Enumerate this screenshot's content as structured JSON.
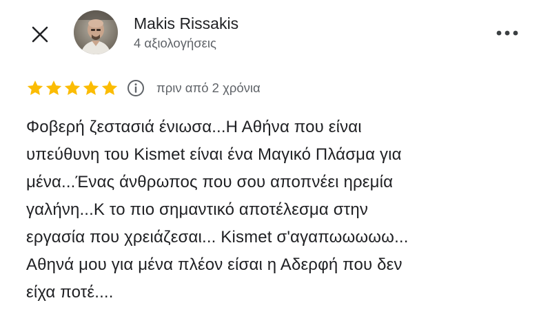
{
  "header": {
    "close_icon": "close-icon",
    "more_icon": "more-horizontal-icon"
  },
  "reviewer": {
    "name": "Makis Rissakis",
    "reviews_count": "4 αξιολογήσεις",
    "avatar_icon": "avatar-photo"
  },
  "review": {
    "rating": 5,
    "rating_max": 5,
    "star_color": "#fbbc04",
    "info_icon": "info-icon",
    "time_ago": "πριν από 2 χρόνια",
    "text": "Φοβερή ζεστασιά ένιωσα...Η Αθήνα που είναι\nυπεύθυνη του Kismet είναι ένα Μαγικό Πλάσμα για\nμένα...Ένας άνθρωπος που σου αποπνέει ηρεμία\nγαλήνη...Κ το πιο σημαντικό αποτέλεσμα στην\nεργασία που χρειάζεσαι... Kismet σ'αγαπωωωωω...\nΑθηνά μου για μένα πλέον είσαι η Αδερφή που δεν\nείχα ποτέ...."
  }
}
